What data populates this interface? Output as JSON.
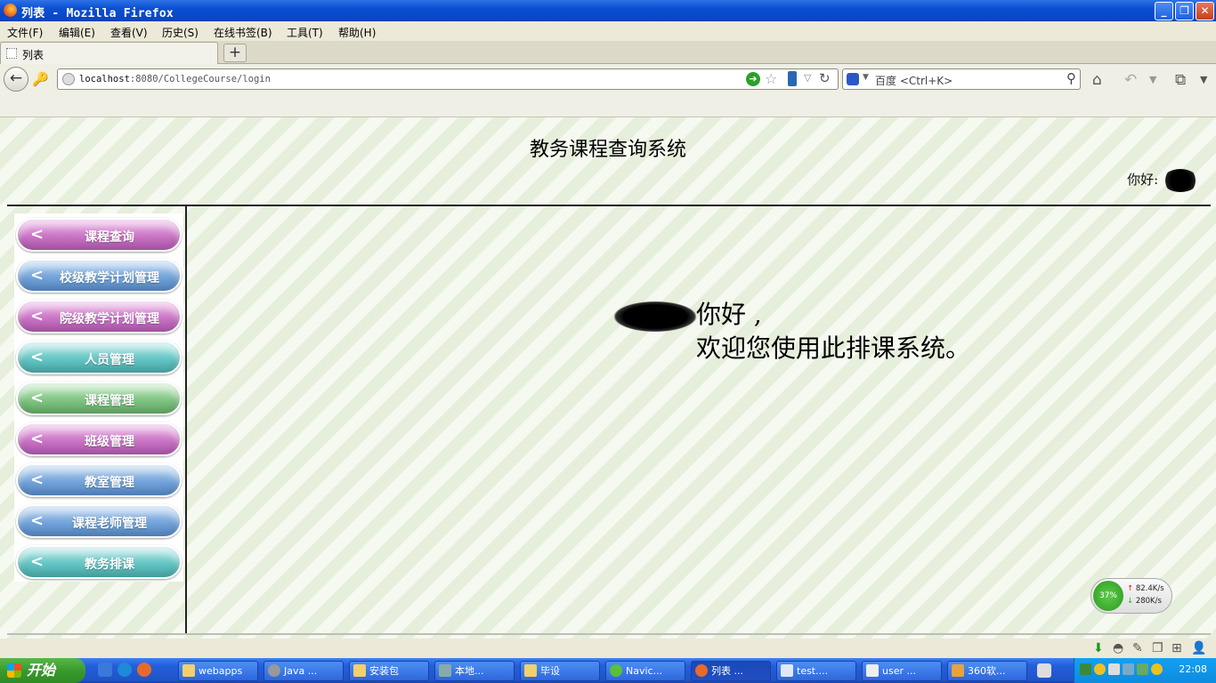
{
  "window": {
    "title": "列表 - Mozilla Firefox"
  },
  "menubar": [
    "文件(F)",
    "编辑(E)",
    "查看(V)",
    "历史(S)",
    "在线书签(B)",
    "工具(T)",
    "帮助(H)"
  ],
  "tabs": [
    {
      "label": "列表"
    }
  ],
  "urlbar": {
    "host": "localhost",
    "path": ":8080/CollegeCourse/login"
  },
  "searchbar": {
    "placeholder": "百度 <Ctrl+K>"
  },
  "page": {
    "title": "教务课程查询系统",
    "greeting_label": "你好:",
    "welcome_suffix": "你好 ,",
    "welcome_line2": "欢迎您使用此排课系统。"
  },
  "sidebar": {
    "items": [
      {
        "label": "课程查询",
        "color": "pink"
      },
      {
        "label": "校级教学计划管理",
        "color": "blue"
      },
      {
        "label": "院级教学计划管理",
        "color": "pink"
      },
      {
        "label": "人员管理",
        "color": "teal"
      },
      {
        "label": "课程管理",
        "color": "green"
      },
      {
        "label": "班级管理",
        "color": "pink"
      },
      {
        "label": "教室管理",
        "color": "blue"
      },
      {
        "label": "课程老师管理",
        "color": "blue"
      },
      {
        "label": "教务排课",
        "color": "teal"
      }
    ]
  },
  "netmeter": {
    "percent": "37%",
    "up": "82.4K/s",
    "down": "280K/s"
  },
  "taskbar": {
    "start": "开始",
    "tasks": [
      "webapps",
      "Java ...",
      "安装包",
      "本地...",
      "毕设",
      "Navic...",
      "列表 ...",
      "test....",
      "user ...",
      "360软..."
    ],
    "clock": "22:08"
  }
}
